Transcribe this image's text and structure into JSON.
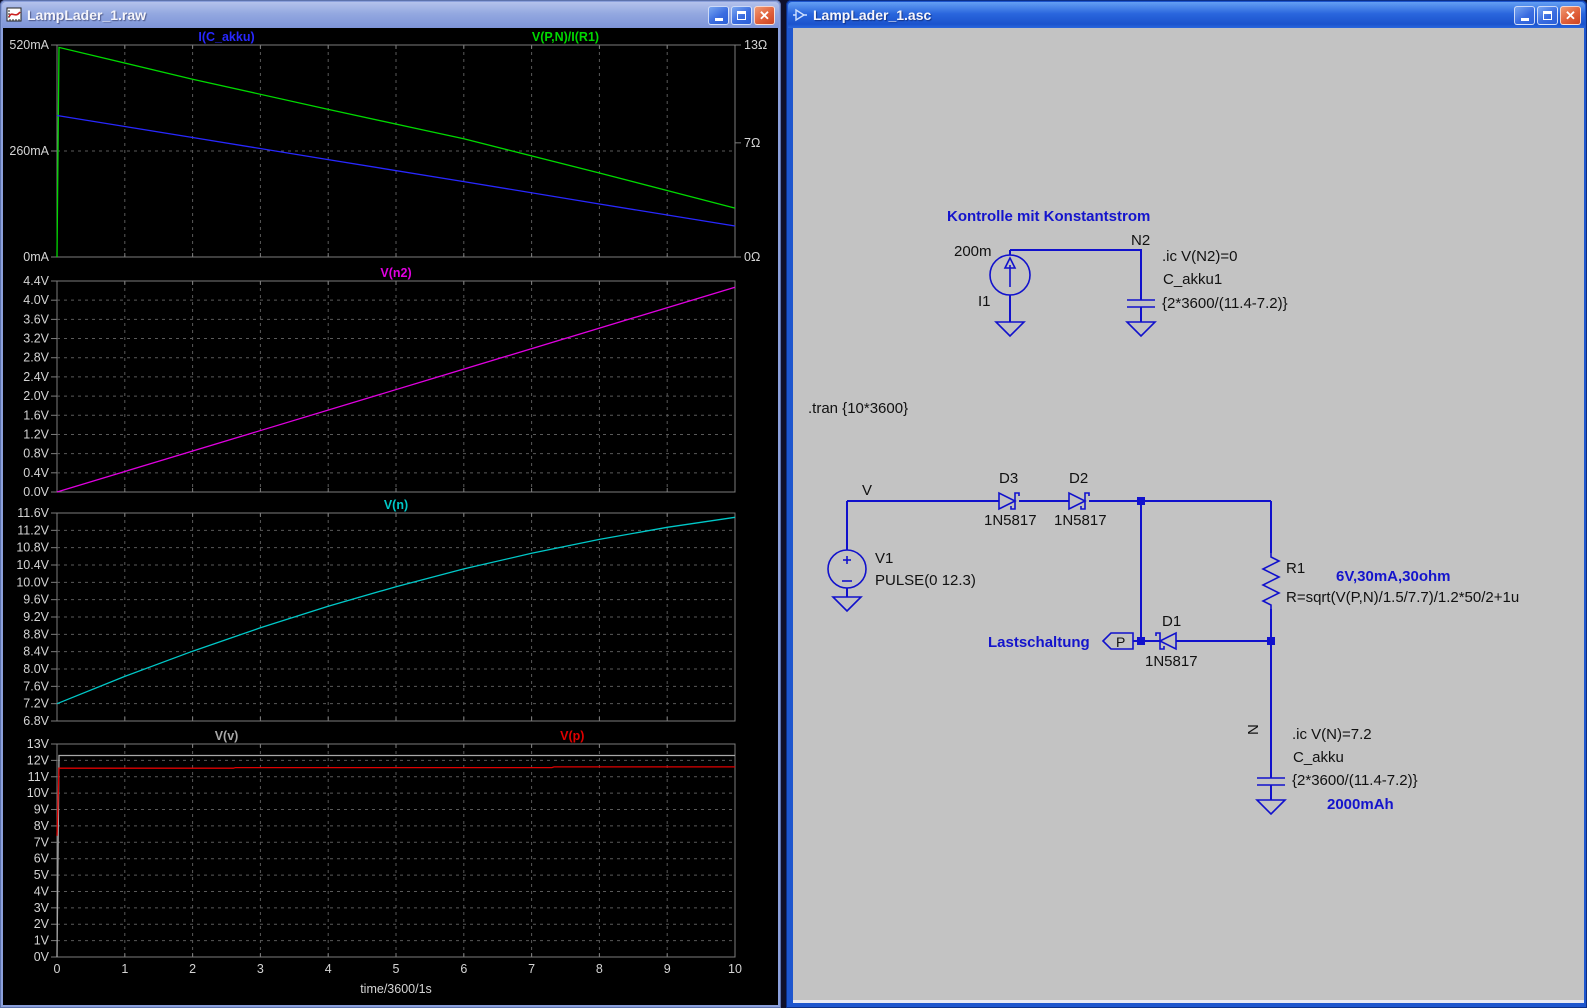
{
  "left_window": {
    "title": "LampLader_1.raw"
  },
  "right_window": {
    "title": "LampLader_1.asc"
  },
  "colors": {
    "wire_blue": "#1111cc",
    "comment_blue": "#1414cc",
    "schematic_bg": "#c3c3c3",
    "plot_bg": "#000000",
    "trace_blue": "#2828ff",
    "trace_green": "#00d800",
    "trace_magenta": "#e000e0",
    "trace_cyan": "#00c8c8",
    "trace_red": "#e00000",
    "trace_gray": "#a8a8a8"
  },
  "chart_data": {
    "type": "line",
    "x": {
      "lim": [
        0,
        10
      ],
      "ticks": [
        "0",
        "1",
        "2",
        "3",
        "4",
        "5",
        "6",
        "7",
        "8",
        "9",
        "10"
      ],
      "label": "time/3600/1s"
    },
    "panes": [
      {
        "titles": [
          {
            "text": "I(C_akku)",
            "color": "#2828ff",
            "xfrac": 0.25
          },
          {
            "text": "V(P,N)/I(R1)",
            "color": "#00d800",
            "xfrac": 0.75
          }
        ],
        "left_axis": {
          "lim": [
            0,
            520
          ],
          "ticks": [
            {
              "v": 520,
              "label": "520mA"
            },
            {
              "v": 260,
              "label": "260mA"
            },
            {
              "v": 0,
              "label": "0mA"
            }
          ]
        },
        "right_axis": {
          "lim": [
            0,
            13
          ],
          "ticks": [
            {
              "v": 13,
              "label": "13Ω"
            },
            {
              "v": 7,
              "label": "7Ω"
            },
            {
              "v": 0,
              "label": "0Ω"
            }
          ]
        },
        "series": [
          {
            "name": "V(P,N)/I(R1)",
            "color": "#00d800",
            "axis": "right",
            "points": [
              [
                0,
                0
              ],
              [
                0.03,
                12.85
              ],
              [
                2,
                10.9
              ],
              [
                4,
                9.05
              ],
              [
                6,
                7.25
              ],
              [
                8,
                5.15
              ],
              [
                10,
                3.0
              ]
            ]
          },
          {
            "name": "I(C_akku)",
            "color": "#2828ff",
            "axis": "left",
            "points": [
              [
                0,
                347
              ],
              [
                2,
                293
              ],
              [
                4,
                239
              ],
              [
                6,
                185
              ],
              [
                8,
                130
              ],
              [
                10,
                76
              ]
            ]
          }
        ]
      },
      {
        "titles": [
          {
            "text": "V(n2)",
            "color": "#e000e0",
            "xfrac": 0.5
          }
        ],
        "left_axis": {
          "lim": [
            0,
            4.4
          ],
          "ticks": [
            {
              "v": 4.4,
              "label": "4.4V"
            },
            {
              "v": 4.0,
              "label": "4.0V"
            },
            {
              "v": 3.6,
              "label": "3.6V"
            },
            {
              "v": 3.2,
              "label": "3.2V"
            },
            {
              "v": 2.8,
              "label": "2.8V"
            },
            {
              "v": 2.4,
              "label": "2.4V"
            },
            {
              "v": 2.0,
              "label": "2.0V"
            },
            {
              "v": 1.6,
              "label": "1.6V"
            },
            {
              "v": 1.2,
              "label": "1.2V"
            },
            {
              "v": 0.8,
              "label": "0.8V"
            },
            {
              "v": 0.4,
              "label": "0.4V"
            },
            {
              "v": 0.0,
              "label": "0.0V"
            }
          ]
        },
        "series": [
          {
            "name": "V(n2)",
            "color": "#e000e0",
            "axis": "left",
            "points": [
              [
                0,
                0
              ],
              [
                10,
                4.27
              ]
            ]
          }
        ]
      },
      {
        "titles": [
          {
            "text": "V(n)",
            "color": "#00c8c8",
            "xfrac": 0.5
          }
        ],
        "left_axis": {
          "lim": [
            6.8,
            11.6
          ],
          "ticks": [
            {
              "v": 11.6,
              "label": "11.6V"
            },
            {
              "v": 11.2,
              "label": "11.2V"
            },
            {
              "v": 10.8,
              "label": "10.8V"
            },
            {
              "v": 10.4,
              "label": "10.4V"
            },
            {
              "v": 10.0,
              "label": "10.0V"
            },
            {
              "v": 9.6,
              "label": "9.6V"
            },
            {
              "v": 9.2,
              "label": "9.2V"
            },
            {
              "v": 8.8,
              "label": "8.8V"
            },
            {
              "v": 8.4,
              "label": "8.4V"
            },
            {
              "v": 8.0,
              "label": "8.0V"
            },
            {
              "v": 7.6,
              "label": "7.6V"
            },
            {
              "v": 7.2,
              "label": "7.2V"
            },
            {
              "v": 6.8,
              "label": "6.8V"
            }
          ]
        },
        "series": [
          {
            "name": "V(n)",
            "color": "#00c8c8",
            "axis": "left",
            "points": [
              [
                0,
                7.2
              ],
              [
                1,
                7.83
              ],
              [
                2,
                8.41
              ],
              [
                3,
                8.95
              ],
              [
                4,
                9.45
              ],
              [
                5,
                9.9
              ],
              [
                6,
                10.31
              ],
              [
                7,
                10.67
              ],
              [
                8,
                10.99
              ],
              [
                9,
                11.27
              ],
              [
                10,
                11.5
              ]
            ]
          }
        ]
      },
      {
        "titles": [
          {
            "text": "V(v)",
            "color": "#a8a8a8",
            "xfrac": 0.25
          },
          {
            "text": "V(p)",
            "color": "#e00000",
            "xfrac": 0.76
          }
        ],
        "left_axis": {
          "lim": [
            0,
            13
          ],
          "ticks": [
            {
              "v": 13,
              "label": "13V"
            },
            {
              "v": 12,
              "label": "12V"
            },
            {
              "v": 11,
              "label": "11V"
            },
            {
              "v": 10,
              "label": "10V"
            },
            {
              "v": 9,
              "label": "9V"
            },
            {
              "v": 8,
              "label": "8V"
            },
            {
              "v": 7,
              "label": "7V"
            },
            {
              "v": 6,
              "label": "6V"
            },
            {
              "v": 5,
              "label": "5V"
            },
            {
              "v": 4,
              "label": "4V"
            },
            {
              "v": 3,
              "label": "3V"
            },
            {
              "v": 2,
              "label": "2V"
            },
            {
              "v": 1,
              "label": "1V"
            },
            {
              "v": 0,
              "label": "0V"
            }
          ]
        },
        "series": [
          {
            "name": "V(v)",
            "color": "#a8a8a8",
            "axis": "left",
            "points": [
              [
                0,
                0
              ],
              [
                0.03,
                12.3
              ],
              [
                10,
                12.3
              ]
            ]
          },
          {
            "name": "V(p)",
            "color": "#e00000",
            "axis": "left",
            "points": [
              [
                0,
                7.4
              ],
              [
                0.03,
                11.52
              ],
              [
                2.6,
                11.52
              ],
              [
                2.63,
                11.56
              ],
              [
                7.3,
                11.56
              ],
              [
                7.33,
                11.6
              ],
              [
                10,
                11.6
              ]
            ]
          }
        ]
      }
    ]
  },
  "schematic": {
    "comment_top": "Kontrolle mit Konstantstrom",
    "i1_value": "200m",
    "i1_name": "I1",
    "n2_node": "N2",
    "ic_n2": ".ic V(N2)=0",
    "cap1_name": "C_akku1",
    "cap1_value": "{2*3600/(11.4-7.2)}",
    "tran": ".tran {10*3600}",
    "v_node": "V",
    "v1_name": "V1",
    "v1_value": "PULSE(0 12.3)",
    "d3_name": "D3",
    "d3_value": "1N5817",
    "d2_name": "D2",
    "d2_value": "1N5817",
    "r1_name": "R1",
    "r1_comment": "6V,30mA,30ohm",
    "r1_value": "R=sqrt(V(P,N)/1.5/7.7)/1.2*50/2+1u",
    "load_comment": "Lastschaltung",
    "p_port": "P",
    "d1_name": "D1",
    "d1_value": "1N5817",
    "n_node": "N",
    "ic_n": ".ic V(N)=7.2",
    "cap2_name": "C_akku",
    "cap2_value": "{2*3600/(11.4-7.2)}",
    "cap2_comment": "2000mAh"
  }
}
